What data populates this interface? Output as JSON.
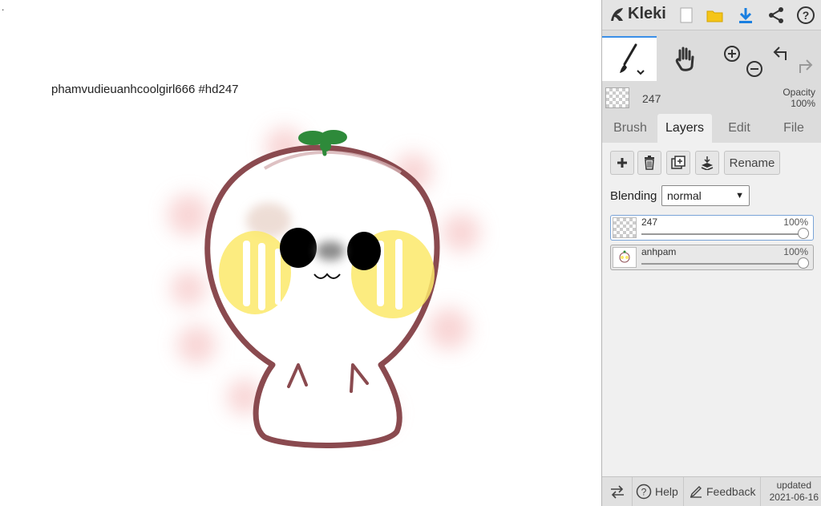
{
  "canvas": {
    "dot": ".",
    "watermark": "phamvudieuanhcoolgirl666 #hd247",
    "illustration_icon": "onion-sprout-character"
  },
  "header": {
    "app_name": "Kleki",
    "icons": [
      "kleki-logo-icon",
      "new-image-icon",
      "open-folder-icon",
      "download-icon",
      "share-icon",
      "help-icon"
    ]
  },
  "tools": {
    "items": [
      {
        "name": "brush-tool",
        "icon": "paintbrush-icon",
        "active": true
      },
      {
        "name": "hand-tool",
        "icon": "hand-icon",
        "active": false
      },
      {
        "name": "zoom-in",
        "icon": "zoom-in-icon"
      },
      {
        "name": "zoom-out",
        "icon": "zoom-out-icon"
      },
      {
        "name": "undo",
        "icon": "undo-icon"
      },
      {
        "name": "redo",
        "icon": "redo-icon"
      }
    ]
  },
  "brush": {
    "name": "247",
    "opacity_label": "Opacity",
    "opacity_value": "100%"
  },
  "tabs": [
    {
      "label": "Brush",
      "active": false
    },
    {
      "label": "Layers",
      "active": true
    },
    {
      "label": "Edit",
      "active": false
    },
    {
      "label": "File",
      "active": false
    }
  ],
  "layers_panel": {
    "buttons": {
      "add_icon": "plus-icon",
      "delete_icon": "trash-icon",
      "duplicate_icon": "duplicate-icon",
      "merge_icon": "merge-down-icon",
      "rename_label": "Rename"
    },
    "blending_label": "Blending",
    "blending_value": "normal",
    "layers": [
      {
        "name": "247",
        "opacity": "100%",
        "opacity_fraction": 1.0,
        "active": true
      },
      {
        "name": "anhpam",
        "opacity": "100%",
        "opacity_fraction": 1.0,
        "active": false
      }
    ]
  },
  "bottom": {
    "swap_icon": "swap-arrows-icon",
    "help_label": "Help",
    "feedback_label": "Feedback",
    "updated_label": "updated",
    "updated_date": "2021-06-16"
  },
  "colors": {
    "accent": "#3a8fe8",
    "outline": "#8a4a4f",
    "cheek": "#fbe96a",
    "leaf": "#2e8a3a"
  }
}
